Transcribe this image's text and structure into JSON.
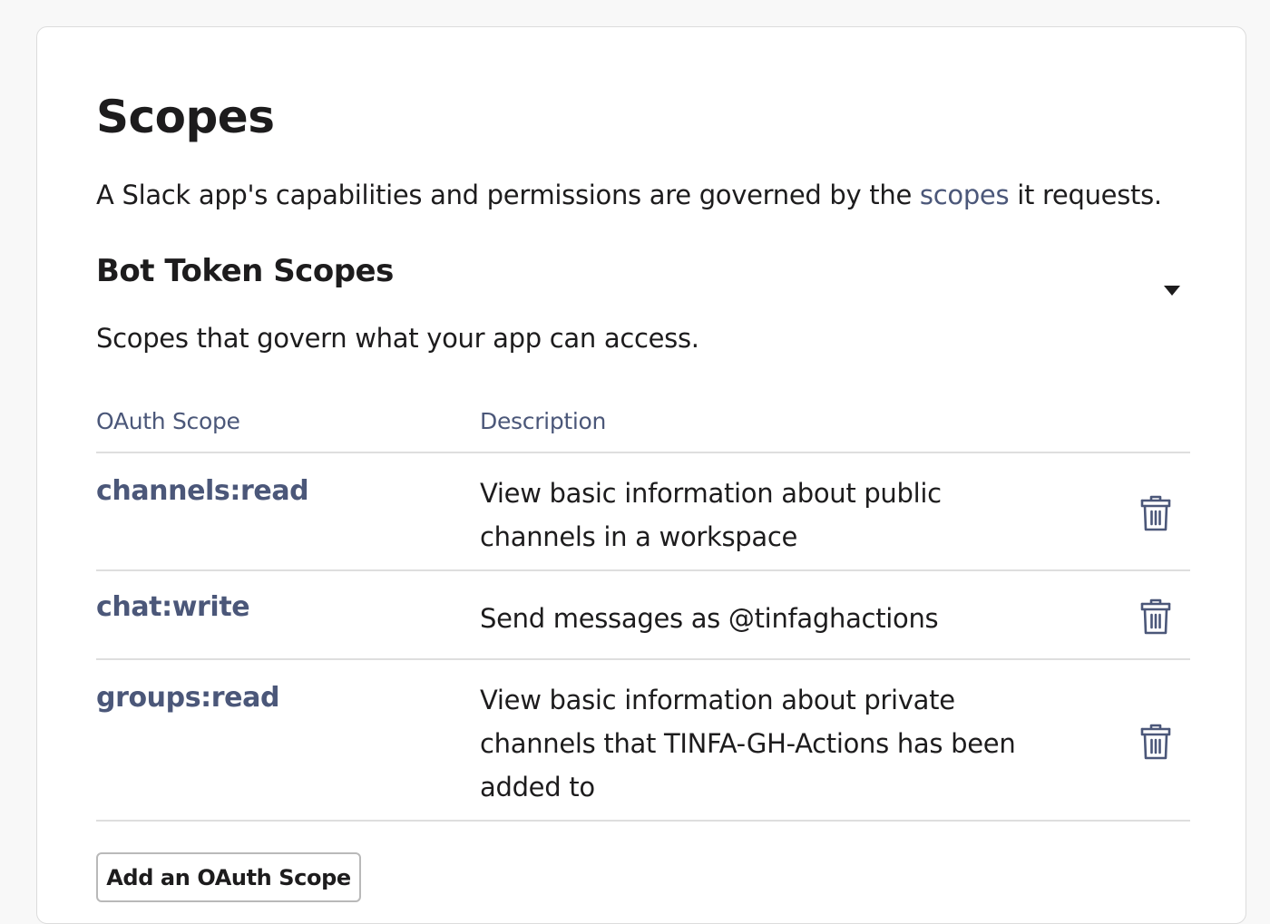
{
  "title": "Scopes",
  "intro": {
    "before": "A Slack app's capabilities and permissions are governed by the ",
    "link": "scopes",
    "after": " it requests."
  },
  "bot_section": {
    "title": "Bot Token Scopes",
    "subtitle": "Scopes that govern what your app can access.",
    "toggle_icon": "caret-down-icon"
  },
  "table": {
    "headers": {
      "scope": "OAuth Scope",
      "description": "Description"
    },
    "rows": [
      {
        "scope": "channels:read",
        "description": "View basic information about public channels in a workspace",
        "action_icon": "trash-icon"
      },
      {
        "scope": "chat:write",
        "description": "Send messages as @tinfaghactions",
        "action_icon": "trash-icon"
      },
      {
        "scope": "groups:read",
        "description": "View basic information about private channels that TINFA-GH-Actions has been added to",
        "action_icon": "trash-icon"
      }
    ]
  },
  "add_button": "Add an OAuth Scope",
  "colors": {
    "background": "#f8f8f8",
    "card": "#ffffff",
    "text": "#1d1c1d",
    "accent": "#4b5779",
    "divider": "#dedede"
  }
}
